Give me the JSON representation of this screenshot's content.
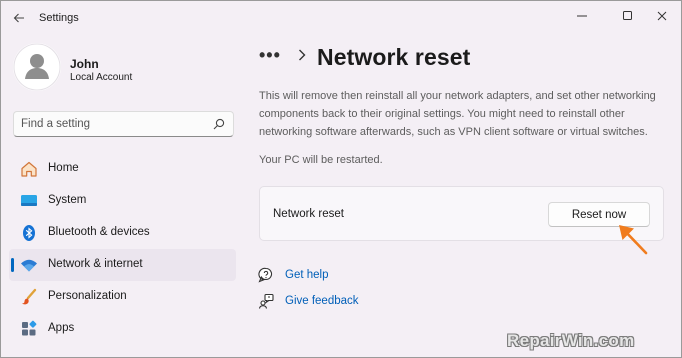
{
  "window": {
    "title": "Settings"
  },
  "profile": {
    "name": "John",
    "account_type": "Local Account"
  },
  "search": {
    "placeholder": "Find a setting"
  },
  "sidebar": {
    "items": [
      {
        "label": "Home",
        "icon": "home-icon"
      },
      {
        "label": "System",
        "icon": "system-icon"
      },
      {
        "label": "Bluetooth & devices",
        "icon": "bluetooth-icon"
      },
      {
        "label": "Network & internet",
        "icon": "wifi-icon",
        "selected": true
      },
      {
        "label": "Personalization",
        "icon": "brush-icon"
      },
      {
        "label": "Apps",
        "icon": "apps-icon"
      }
    ]
  },
  "main": {
    "breadcrumb_more": "•••",
    "title": "Network reset",
    "description": "This will remove then reinstall all your network adapters, and set other networking components back to their original settings. You might need to reinstall other networking software afterwards, such as VPN client software or virtual switches.",
    "restart_note": "Your PC will be restarted.",
    "card": {
      "label": "Network reset",
      "button_label": "Reset now"
    },
    "links": [
      {
        "label": "Get help",
        "icon": "help-icon"
      },
      {
        "label": "Give feedback",
        "icon": "feedback-icon"
      }
    ]
  },
  "watermark": "RepairWin.com",
  "colors": {
    "accent": "#0067c0",
    "link": "#005fb8",
    "arrow": "#f07c1e",
    "background": "#f4eff5"
  }
}
